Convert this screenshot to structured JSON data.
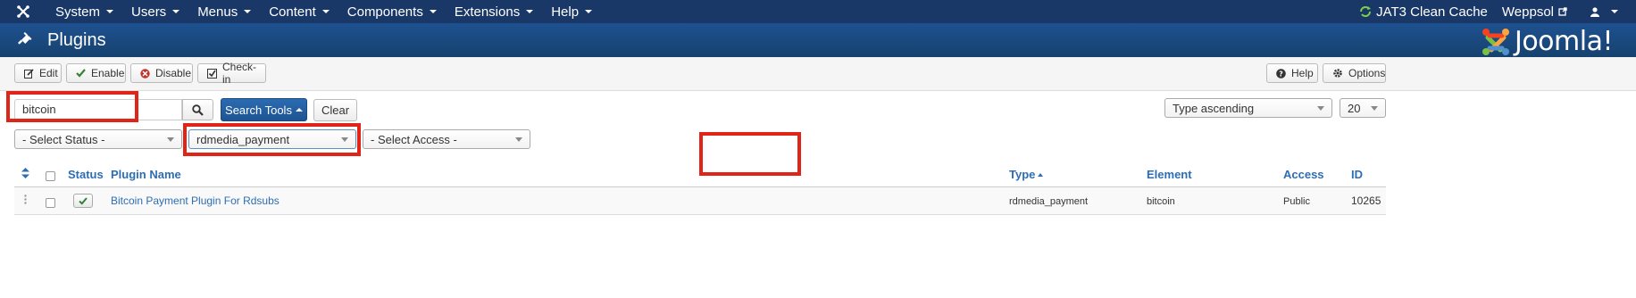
{
  "nav": {
    "items": [
      {
        "label": "System"
      },
      {
        "label": "Users"
      },
      {
        "label": "Menus"
      },
      {
        "label": "Content"
      },
      {
        "label": "Components"
      },
      {
        "label": "Extensions"
      },
      {
        "label": "Help"
      }
    ],
    "cache_label": "JAT3 Clean Cache",
    "site_label": "Weppsol"
  },
  "header": {
    "title": "Plugins",
    "brand": "Joomla!"
  },
  "toolbar": {
    "edit": "Edit",
    "enable": "Enable",
    "disable": "Disable",
    "checkin": "Check-in",
    "help": "Help",
    "options": "Options"
  },
  "filters": {
    "search_value": "bitcoin",
    "search_tools": "Search Tools",
    "clear": "Clear",
    "sort": "Type ascending",
    "limit": "20",
    "status": "- Select Status -",
    "type": "rdmedia_payment",
    "access": "- Select Access -"
  },
  "table": {
    "headers": {
      "status": "Status",
      "name": "Plugin Name",
      "type": "Type",
      "element": "Element",
      "access": "Access",
      "id": "ID"
    },
    "rows": [
      {
        "name": "Bitcoin Payment Plugin For Rdsubs",
        "type": "rdmedia_payment",
        "element": "bitcoin",
        "access": "Public",
        "id": "10265",
        "enabled": true
      }
    ]
  },
  "colors": {
    "navbar": "#1a3867",
    "header": "#1c4a83",
    "link": "#2d6db4",
    "highlight": "#e02418",
    "primary_button": "#2b6cb3"
  }
}
